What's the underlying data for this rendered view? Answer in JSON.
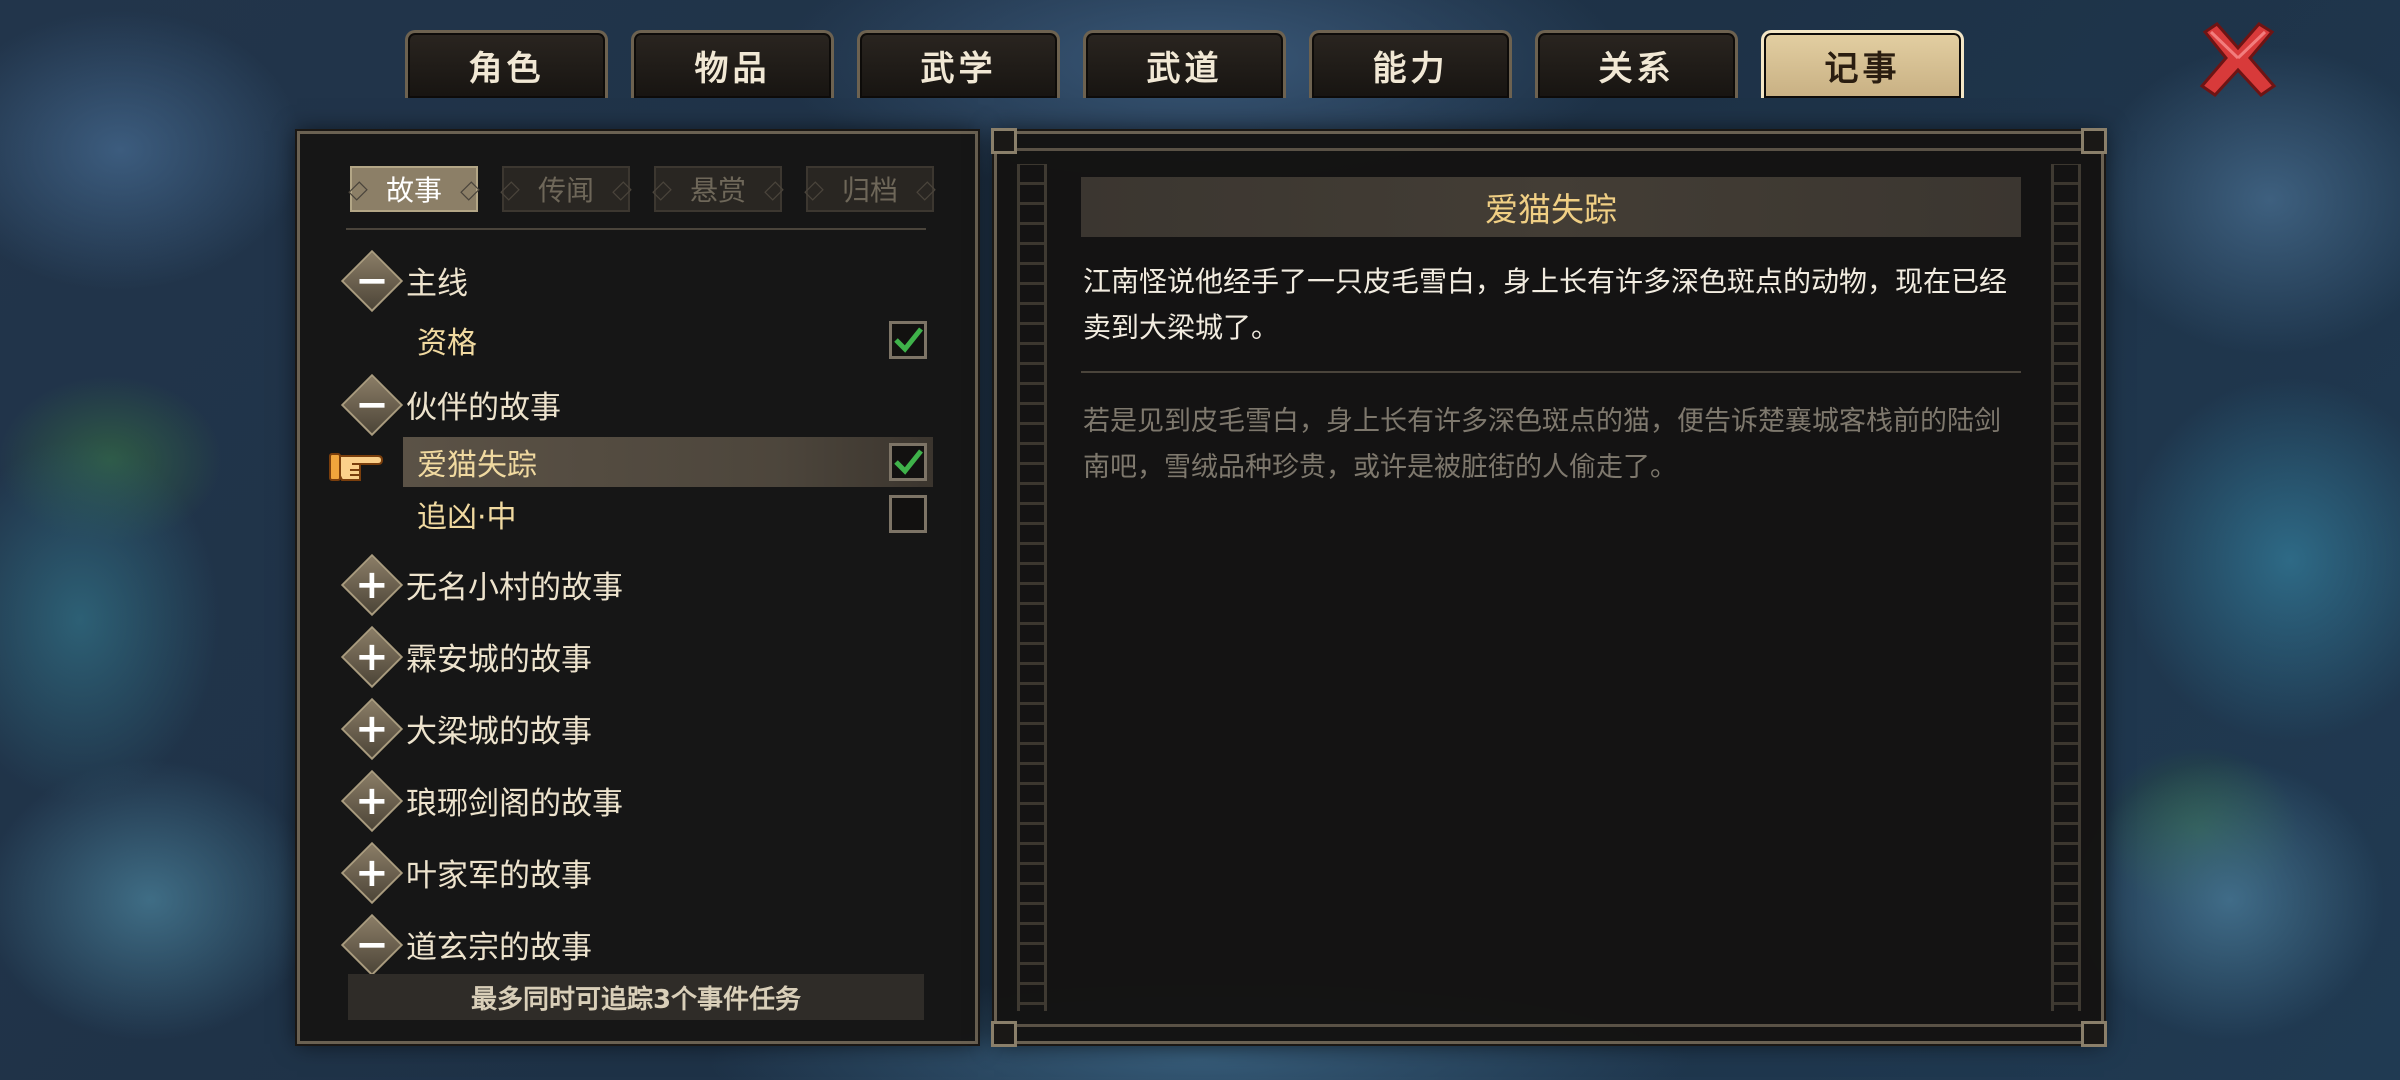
{
  "tabs": [
    {
      "label": "角色",
      "active": false
    },
    {
      "label": "物品",
      "active": false
    },
    {
      "label": "武学",
      "active": false
    },
    {
      "label": "武道",
      "active": false
    },
    {
      "label": "能力",
      "active": false
    },
    {
      "label": "关系",
      "active": false
    },
    {
      "label": "记事",
      "active": true
    }
  ],
  "close_icon": "close-x-icon",
  "subtabs": [
    {
      "label": "故事",
      "active": true
    },
    {
      "label": "传闻",
      "active": false
    },
    {
      "label": "悬赏",
      "active": false
    },
    {
      "label": "归档",
      "active": false
    }
  ],
  "tree": {
    "main": {
      "label": "主线",
      "expanded": true,
      "items": [
        {
          "label": "资格",
          "checked": true
        }
      ]
    },
    "companion": {
      "label": "伙伴的故事",
      "expanded": true,
      "items": [
        {
          "label": "爱猫失踪",
          "checked": true,
          "selected": true
        },
        {
          "label": "追凶·中",
          "checked": false
        }
      ]
    },
    "village": {
      "label": "无名小村的故事",
      "expanded": false
    },
    "linan": {
      "label": "霖安城的故事",
      "expanded": false
    },
    "daliang": {
      "label": "大梁城的故事",
      "expanded": false
    },
    "langya": {
      "label": "琅琊剑阁的故事",
      "expanded": false
    },
    "yejia": {
      "label": "叶家军的故事",
      "expanded": false
    },
    "daoxuan": {
      "label": "道玄宗的故事",
      "expanded": true
    }
  },
  "footer_note": "最多同时可追踪3个事件任务",
  "detail": {
    "title": "爱猫失踪",
    "body": "江南怪说他经手了一只皮毛雪白，身上长有许多深色斑点的动物，现在已经卖到大梁城了。",
    "note": "若是见到皮毛雪白，身上长有许多深色斑点的猫，便告诉楚襄城客栈前的陆剑南吧，雪绒品种珍贵，或许是被脏街的人偷走了。"
  },
  "colors": {
    "accent_gold": "#f0cf84",
    "active_tab": "#d8c396",
    "check_green": "#3fb24a",
    "close_red": "#d83a3a"
  }
}
